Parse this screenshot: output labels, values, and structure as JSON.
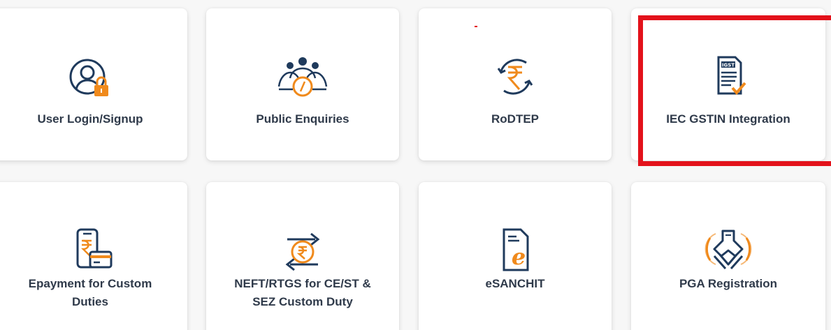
{
  "colors": {
    "icon_navy": "#1f3a5c",
    "icon_orange": "#f08a1c",
    "label_text": "#2f3a4a",
    "highlight_red": "#e3121b",
    "card_bg": "#ffffff",
    "page_bg": "#f7f7f7"
  },
  "services": [
    {
      "label": "User Login/Signup",
      "icon": "user-lock-icon"
    },
    {
      "label": "Public Enquiries",
      "icon": "people-info-icon"
    },
    {
      "label": "RoDTEP",
      "icon": "rupee-refresh-icon"
    },
    {
      "label": "IEC GSTIN Integration",
      "icon": "gst-document-check-icon"
    },
    {
      "label": "Epayment for Custom\nDuties",
      "icon": "phone-card-payment-icon"
    },
    {
      "label": "NEFT/RTGS for CE/ST &\nSEZ Custom Duty",
      "icon": "rupee-transfer-icon"
    },
    {
      "label": "eSANCHIT",
      "icon": "e-document-icon"
    },
    {
      "label": "PGA Registration",
      "icon": "handshake-icon"
    }
  ]
}
